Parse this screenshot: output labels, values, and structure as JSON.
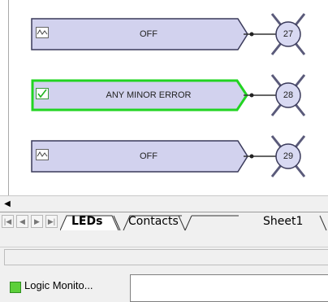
{
  "leds": [
    {
      "label": "OFF",
      "number": "27",
      "checked": false
    },
    {
      "label": "ANY MINOR ERROR",
      "number": "28",
      "checked": true
    },
    {
      "label": "OFF",
      "number": "29",
      "checked": false
    }
  ],
  "sheet_tabs": [
    {
      "label": "LEDs",
      "active": true
    },
    {
      "label": "Contacts",
      "active": false
    },
    {
      "label": "Sheet1",
      "active": false
    }
  ],
  "status": {
    "label": "Logic Monito..."
  },
  "colors": {
    "box_fill": "#d2d2ee",
    "box_border": "#3a3a5a",
    "active_border": "#22d422",
    "circle_fill": "#d8d9f2"
  }
}
